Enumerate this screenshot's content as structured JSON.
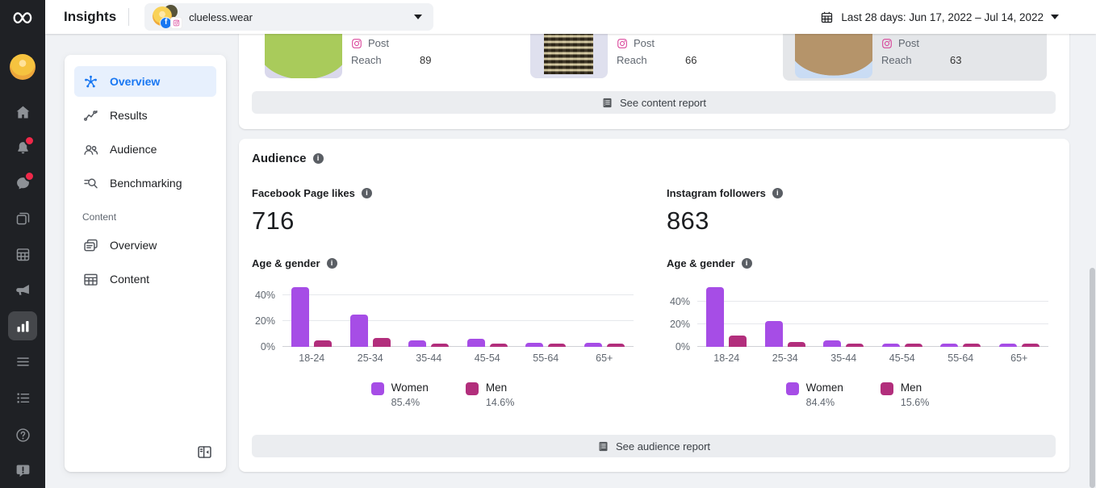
{
  "colors": {
    "accent_blue": "#1877f2",
    "women_bar": "#a64de6",
    "men_bar": "#b22e7c",
    "instagram_pink": "#d6308f",
    "badge_red": "#f02849"
  },
  "topbar": {
    "title": "Insights",
    "account_name": "clueless.wear",
    "date_range": "Last 28 days: Jun 17, 2022 – Jul 14, 2022",
    "calendar_icon": "calendar-icon",
    "caret_icon": "chevron-down-icon"
  },
  "rail": {
    "logo_icon": "meta-logo",
    "items": [
      {
        "name": "profile-avatar",
        "type": "avatar"
      },
      {
        "name": "home-icon"
      },
      {
        "name": "notifications-icon",
        "badge": true
      },
      {
        "name": "messages-icon",
        "badge": true
      },
      {
        "name": "posts-icon"
      },
      {
        "name": "planner-icon"
      },
      {
        "name": "ads-icon"
      },
      {
        "name": "insights-icon",
        "selected": true
      },
      {
        "name": "more-tools-icon"
      },
      {
        "name": "tasks-icon"
      },
      {
        "name": "help-icon"
      },
      {
        "name": "feedback-icon"
      }
    ]
  },
  "sidebar": {
    "items": [
      {
        "label": "Overview",
        "icon": "overview-hub-icon",
        "active": true
      },
      {
        "label": "Results",
        "icon": "results-icon"
      },
      {
        "label": "Audience",
        "icon": "audience-icon"
      },
      {
        "label": "Benchmarking",
        "icon": "benchmarking-icon"
      }
    ],
    "section_label": "Content",
    "section_items": [
      {
        "label": "Overview",
        "icon": "content-overview-icon"
      },
      {
        "label": "Content",
        "icon": "content-table-icon"
      }
    ],
    "collapse_icon": "collapse-sidebar-icon"
  },
  "content_panel": {
    "cards": [
      {
        "platform_icon": "instagram-icon",
        "type_label": "Post",
        "metric_label": "Reach",
        "value": "89",
        "thumb": "green-shirt"
      },
      {
        "platform_icon": "instagram-icon",
        "type_label": "Post",
        "metric_label": "Reach",
        "value": "66",
        "thumb": "checkered-top"
      },
      {
        "platform_icon": "instagram-icon",
        "type_label": "Post",
        "metric_label": "Reach",
        "value": "63",
        "thumb": "tan-top",
        "highlighted": true
      }
    ],
    "report_button": {
      "icon": "report-icon",
      "label": "See content report"
    }
  },
  "audience": {
    "title": "Audience",
    "facebook": {
      "metric_label": "Facebook Page likes",
      "metric_value": "716",
      "age_gender_label": "Age & gender"
    },
    "instagram": {
      "metric_label": "Instagram followers",
      "metric_value": "863",
      "age_gender_label": "Age & gender"
    },
    "report_button": {
      "icon": "report-icon",
      "label": "See audience report"
    }
  },
  "chart_data": [
    {
      "type": "bar",
      "platform": "Facebook",
      "title": "Age & gender",
      "categories": [
        "18-24",
        "25-34",
        "35-44",
        "45-54",
        "55-64",
        "65+"
      ],
      "series": [
        {
          "name": "Women",
          "color": "#a64de6",
          "share": "85.4%",
          "values": [
            46,
            25,
            5,
            6,
            3,
            3
          ]
        },
        {
          "name": "Men",
          "color": "#b22e7c",
          "share": "14.6%",
          "values": [
            5,
            7,
            2.5,
            2.5,
            2.5,
            2.5
          ]
        }
      ],
      "yticks": [
        0,
        20,
        40
      ],
      "ytick_suffix": "%",
      "ymax": 50,
      "grid": true,
      "legend_position": "bottom-center"
    },
    {
      "type": "bar",
      "platform": "Instagram",
      "title": "Age & gender",
      "categories": [
        "18-24",
        "25-34",
        "35-44",
        "45-54",
        "55-64",
        "65+"
      ],
      "series": [
        {
          "name": "Women",
          "color": "#a64de6",
          "share": "84.4%",
          "values": [
            53,
            23,
            6,
            3,
            3,
            3
          ]
        },
        {
          "name": "Men",
          "color": "#b22e7c",
          "share": "15.6%",
          "values": [
            10,
            4,
            3,
            3,
            3,
            3
          ]
        }
      ],
      "yticks": [
        0,
        20,
        40
      ],
      "ytick_suffix": "%",
      "ymax": 57,
      "grid": true,
      "legend_position": "bottom-center"
    }
  ]
}
